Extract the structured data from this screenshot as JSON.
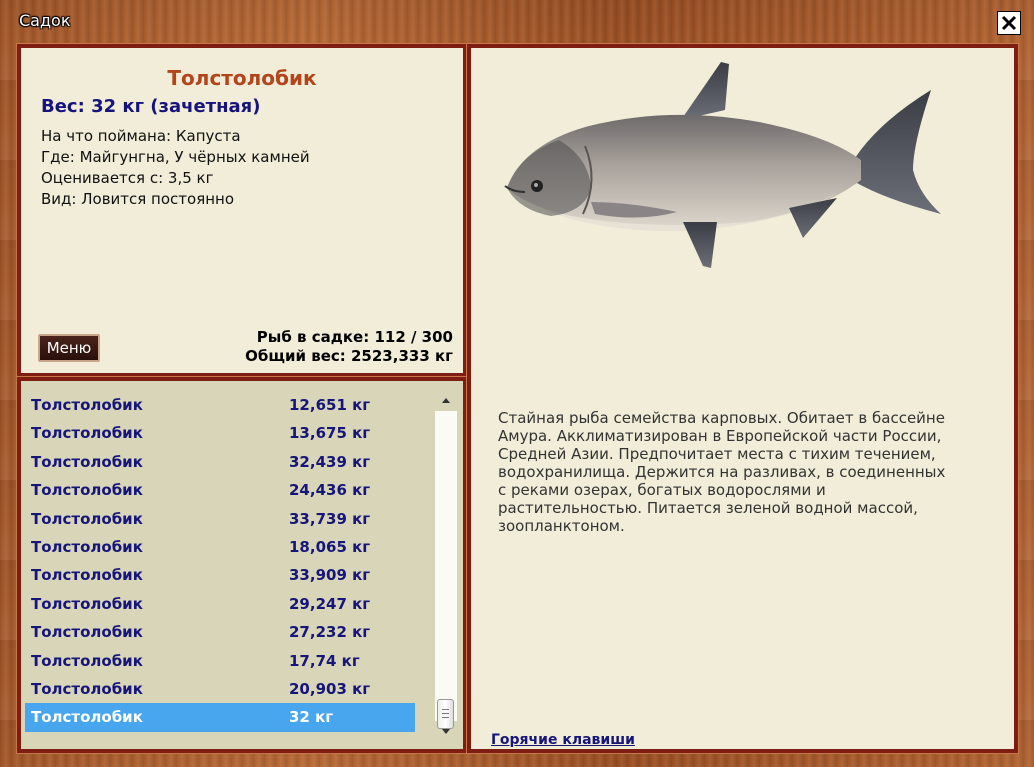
{
  "window": {
    "title": "Садок",
    "close_icon": "close-icon"
  },
  "info": {
    "name": "Толстолобик",
    "weight_line": "Вес: 32 кг (зачетная)",
    "bait": "На что поймана: Капуста",
    "place": "Где: Майгунгна, У чёрных камней",
    "rated_from": "Оценивается с: 3,5 кг",
    "kind": "Вид: Ловится постоянно",
    "menu_label": "Меню",
    "fish_count": "Рыб в садке: 112 / 300",
    "total_weight": "Общий вес: 2523,333 кг"
  },
  "list": [
    {
      "name": "Толстолобик",
      "weight": "12,651 кг"
    },
    {
      "name": "Толстолобик",
      "weight": "13,675 кг"
    },
    {
      "name": "Толстолобик",
      "weight": "32,439 кг"
    },
    {
      "name": "Толстолобик",
      "weight": "24,436 кг"
    },
    {
      "name": "Толстолобик",
      "weight": "33,739 кг"
    },
    {
      "name": "Толстолобик",
      "weight": "18,065 кг"
    },
    {
      "name": "Толстолобик",
      "weight": "33,909 кг"
    },
    {
      "name": "Толстолобик",
      "weight": "29,247 кг"
    },
    {
      "name": "Толстолобик",
      "weight": "27,232 кг"
    },
    {
      "name": "Толстолобик",
      "weight": "17,74 кг"
    },
    {
      "name": "Толстолобик",
      "weight": "20,903 кг"
    },
    {
      "name": "Толстолобик",
      "weight": "32 кг",
      "selected": true
    }
  ],
  "description": "Стайная рыба семейства карповых. Обитает в бассейне Амура. Акклиматизирован в Европейской части России, Средней Азии. Предпочитает места с тихим течением, водохранилища. Держится на разливах, в соединенных с реками озерах, богатых водорослями и растительностью. Питается зеленой водной массой, зоопланктоном.",
  "hotkeys_link": "Горячие клавиши",
  "colors": {
    "frame_border": "#7e1e12",
    "panel_bg": "#f1edd8",
    "list_bg": "#d8d5b9",
    "selection": "#47a6ee",
    "name_color": "#b4441a",
    "list_text": "#15157a"
  }
}
